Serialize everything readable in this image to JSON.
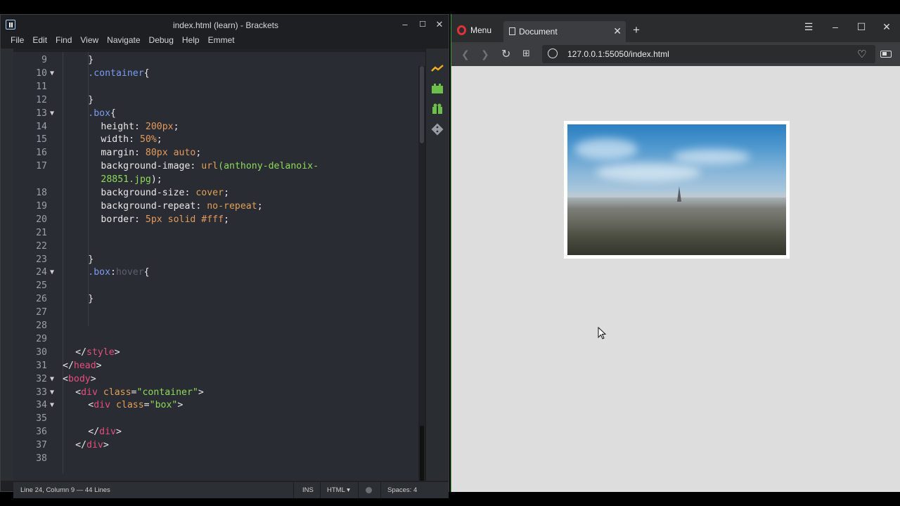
{
  "brackets": {
    "title": "index.html (learn) - Brackets",
    "menu": [
      "File",
      "Edit",
      "Find",
      "View",
      "Navigate",
      "Debug",
      "Help",
      "Emmet"
    ],
    "window_controls": {
      "minimize": "–",
      "maximize": "☐",
      "close": "✕"
    },
    "status": {
      "position": "Line 24, Column 9 — 44 Lines",
      "mode": "INS",
      "language": "HTML",
      "spaces": "Spaces: 4"
    }
  },
  "code_lines": [
    {
      "n": "9",
      "fold": "",
      "indent": 8,
      "parts": [
        [
          "}",
          "c-brace"
        ]
      ]
    },
    {
      "n": "10",
      "fold": "▼",
      "indent": 8,
      "parts": [
        [
          ".container",
          "c-sel"
        ],
        [
          "{",
          "c-brace"
        ]
      ]
    },
    {
      "n": "11",
      "fold": "",
      "indent": 0,
      "parts": []
    },
    {
      "n": "12",
      "fold": "",
      "indent": 8,
      "parts": [
        [
          "}",
          "c-brace"
        ]
      ]
    },
    {
      "n": "13",
      "fold": "▼",
      "indent": 8,
      "parts": [
        [
          ".box",
          "c-sel"
        ],
        [
          "{",
          "c-brace"
        ]
      ]
    },
    {
      "n": "14",
      "fold": "",
      "indent": 12,
      "parts": [
        [
          "height: ",
          "c-prop"
        ],
        [
          "200px",
          "c-num"
        ],
        [
          ";",
          "c-prop"
        ]
      ]
    },
    {
      "n": "15",
      "fold": "",
      "indent": 12,
      "parts": [
        [
          "width: ",
          "c-prop"
        ],
        [
          "50%",
          "c-num"
        ],
        [
          ";",
          "c-prop"
        ]
      ]
    },
    {
      "n": "16",
      "fold": "",
      "indent": 12,
      "parts": [
        [
          "margin: ",
          "c-prop"
        ],
        [
          "80px auto",
          "c-num"
        ],
        [
          ";",
          "c-prop"
        ]
      ]
    },
    {
      "n": "17",
      "fold": "",
      "indent": 12,
      "parts": [
        [
          "background-image: ",
          "c-prop"
        ],
        [
          "url",
          "c-kw"
        ],
        [
          "(anthony-delanoix-",
          "c-str"
        ]
      ]
    },
    {
      "n": "",
      "fold": "",
      "indent": 12,
      "parts": [
        [
          "28851.jpg",
          "c-str"
        ],
        [
          ");",
          "c-prop"
        ]
      ]
    },
    {
      "n": "18",
      "fold": "",
      "indent": 12,
      "parts": [
        [
          "background-size: ",
          "c-prop"
        ],
        [
          "cover",
          "c-kw"
        ],
        [
          ";",
          "c-prop"
        ]
      ]
    },
    {
      "n": "19",
      "fold": "",
      "indent": 12,
      "parts": [
        [
          "background-repeat: ",
          "c-prop"
        ],
        [
          "no-repeat",
          "c-kw"
        ],
        [
          ";",
          "c-prop"
        ]
      ]
    },
    {
      "n": "20",
      "fold": "",
      "indent": 12,
      "parts": [
        [
          "border: ",
          "c-prop"
        ],
        [
          "5px solid #fff",
          "c-num"
        ],
        [
          ";",
          "c-prop"
        ]
      ]
    },
    {
      "n": "21",
      "fold": "",
      "indent": 0,
      "parts": []
    },
    {
      "n": "22",
      "fold": "",
      "indent": 0,
      "parts": []
    },
    {
      "n": "23",
      "fold": "",
      "indent": 8,
      "parts": [
        [
          "}",
          "c-brace"
        ]
      ]
    },
    {
      "n": "24",
      "fold": "▼",
      "indent": 8,
      "parts": [
        [
          ".box",
          "c-sel"
        ],
        [
          ":",
          "c-prop"
        ],
        [
          "hover",
          "c-dim"
        ],
        [
          "{",
          "c-brace"
        ]
      ]
    },
    {
      "n": "25",
      "fold": "",
      "indent": 0,
      "parts": []
    },
    {
      "n": "26",
      "fold": "",
      "indent": 8,
      "parts": [
        [
          "}",
          "c-brace"
        ]
      ]
    },
    {
      "n": "27",
      "fold": "",
      "indent": 0,
      "parts": []
    },
    {
      "n": "28",
      "fold": "",
      "indent": 0,
      "parts": []
    },
    {
      "n": "29",
      "fold": "",
      "indent": 0,
      "parts": []
    },
    {
      "n": "30",
      "fold": "",
      "indent": 4,
      "parts": [
        [
          "</",
          "c-brace"
        ],
        [
          "style",
          "c-tag"
        ],
        [
          ">",
          "c-brace"
        ]
      ]
    },
    {
      "n": "31",
      "fold": "",
      "indent": 0,
      "parts": [
        [
          "</",
          "c-brace"
        ],
        [
          "head",
          "c-tag"
        ],
        [
          ">",
          "c-brace"
        ]
      ]
    },
    {
      "n": "32",
      "fold": "▼",
      "indent": 0,
      "parts": [
        [
          "<",
          "c-brace"
        ],
        [
          "body",
          "c-tag"
        ],
        [
          ">",
          "c-brace"
        ]
      ]
    },
    {
      "n": "33",
      "fold": "▼",
      "indent": 4,
      "parts": [
        [
          "<",
          "c-brace"
        ],
        [
          "div ",
          "c-tag"
        ],
        [
          "class",
          "c-attr"
        ],
        [
          "=",
          "c-brace"
        ],
        [
          "\"container\"",
          "c-str"
        ],
        [
          ">",
          "c-brace"
        ]
      ]
    },
    {
      "n": "34",
      "fold": "▼",
      "indent": 8,
      "parts": [
        [
          "<",
          "c-brace"
        ],
        [
          "div ",
          "c-tag"
        ],
        [
          "class",
          "c-attr"
        ],
        [
          "=",
          "c-brace"
        ],
        [
          "\"box\"",
          "c-str"
        ],
        [
          ">",
          "c-brace"
        ]
      ]
    },
    {
      "n": "35",
      "fold": "",
      "indent": 0,
      "parts": []
    },
    {
      "n": "36",
      "fold": "",
      "indent": 8,
      "parts": [
        [
          "</",
          "c-brace"
        ],
        [
          "div",
          "c-tag"
        ],
        [
          ">",
          "c-brace"
        ]
      ]
    },
    {
      "n": "37",
      "fold": "",
      "indent": 4,
      "parts": [
        [
          "</",
          "c-brace"
        ],
        [
          "div",
          "c-tag"
        ],
        [
          ">",
          "c-brace"
        ]
      ]
    },
    {
      "n": "38",
      "fold": "",
      "indent": 0,
      "parts": []
    }
  ],
  "browser": {
    "menu_label": "Menu",
    "tab_title": "Document",
    "new_tab": "+",
    "url": "127.0.0.1:55050/index.html",
    "window_controls": {
      "menu": "☰",
      "minimize": "–",
      "maximize": "☐",
      "close": "✕"
    }
  },
  "colors": {
    "brackets_bg": "#292c33",
    "selector": "#7a9cf0",
    "number": "#e59a5c",
    "string": "#8fd95a",
    "tag": "#e64f7c",
    "opera_red": "#e0323a",
    "page_bg": "#dddddd"
  }
}
